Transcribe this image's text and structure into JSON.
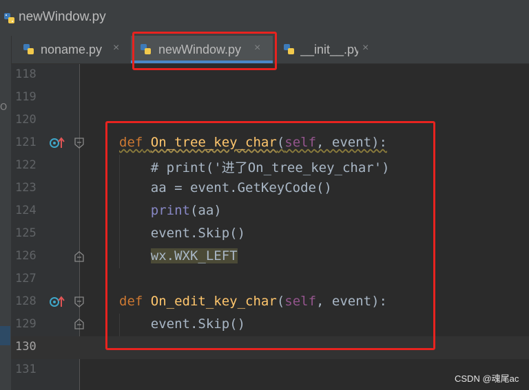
{
  "window": {
    "title": "newWindow.py"
  },
  "tabs": [
    {
      "label": "noname.py",
      "close": "×",
      "active": false
    },
    {
      "label": "newWindow.py",
      "close": "×",
      "active": true
    },
    {
      "label": "__init__.py",
      "close": "×",
      "active": false
    }
  ],
  "left_strip": {
    "mark": "O"
  },
  "editor": {
    "current_line": 130,
    "lines": [
      {
        "num": "118",
        "code": ""
      },
      {
        "num": "119",
        "code": ""
      },
      {
        "num": "120",
        "code": ""
      },
      {
        "num": "121",
        "code": "def On_tree_key_char(self, event):",
        "def_kw": "def",
        "fn_name": "On_tree_key_char",
        "self_kw": "self",
        "rest": ", event):"
      },
      {
        "num": "122",
        "code": "    # print('进了On_tree_key_char')"
      },
      {
        "num": "123",
        "code": "    aa = event.GetKeyCode()"
      },
      {
        "num": "124",
        "code": "    print(aa)",
        "builtin": "print",
        "rest": "(aa)"
      },
      {
        "num": "125",
        "code": "    event.Skip()"
      },
      {
        "num": "126",
        "code": "wx.WXK_LEFT"
      },
      {
        "num": "127",
        "code": ""
      },
      {
        "num": "128",
        "code": "def On_edit_key_char(self, event):",
        "def_kw": "def",
        "fn_name": "On_edit_key_char",
        "self_kw": "self",
        "rest": ", event):"
      },
      {
        "num": "129",
        "code": "    event.Skip()"
      },
      {
        "num": "130",
        "code": ""
      },
      {
        "num": "131",
        "code": ""
      }
    ]
  },
  "icons": {
    "python_file": "python-file-icon",
    "override": "override-method-icon",
    "fold": "fold-marker-icon"
  },
  "colors": {
    "highlight_box": "#e8231f",
    "keyword": "#cc7832",
    "function": "#ffc66d",
    "self": "#94558d",
    "comment": "#808080",
    "tab_underline": "#4a88c7"
  },
  "watermark": "CSDN @魂尾ac"
}
